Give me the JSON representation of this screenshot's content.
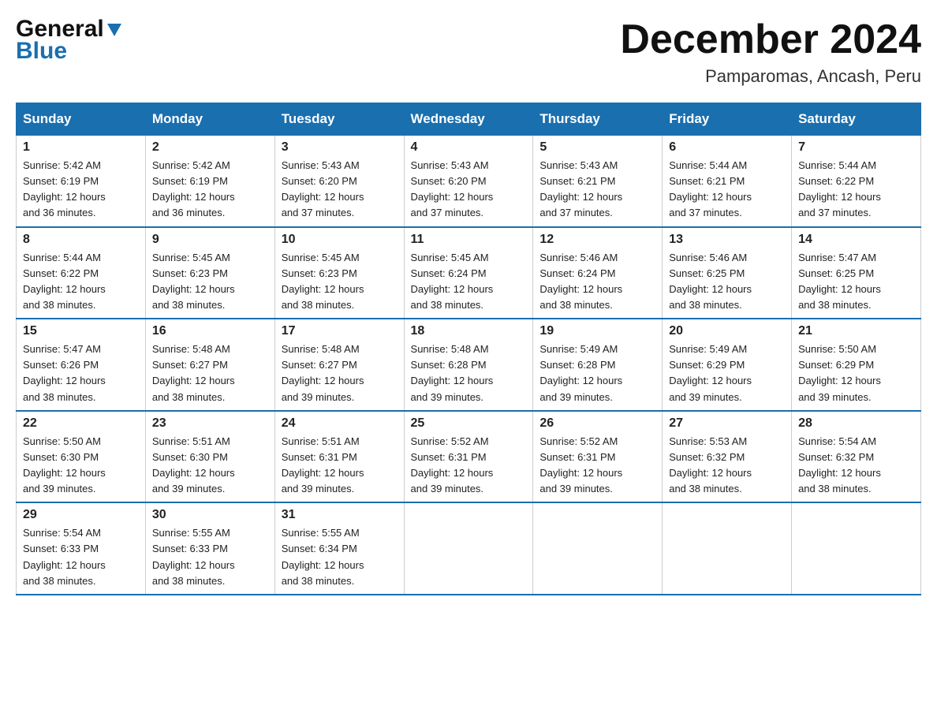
{
  "header": {
    "logo_general": "General",
    "logo_blue": "Blue",
    "month_title": "December 2024",
    "subtitle": "Pamparomas, Ancash, Peru"
  },
  "days_of_week": [
    "Sunday",
    "Monday",
    "Tuesday",
    "Wednesday",
    "Thursday",
    "Friday",
    "Saturday"
  ],
  "weeks": [
    [
      {
        "day": "1",
        "sunrise": "5:42 AM",
        "sunset": "6:19 PM",
        "daylight": "12 hours and 36 minutes."
      },
      {
        "day": "2",
        "sunrise": "5:42 AM",
        "sunset": "6:19 PM",
        "daylight": "12 hours and 36 minutes."
      },
      {
        "day": "3",
        "sunrise": "5:43 AM",
        "sunset": "6:20 PM",
        "daylight": "12 hours and 37 minutes."
      },
      {
        "day": "4",
        "sunrise": "5:43 AM",
        "sunset": "6:20 PM",
        "daylight": "12 hours and 37 minutes."
      },
      {
        "day": "5",
        "sunrise": "5:43 AM",
        "sunset": "6:21 PM",
        "daylight": "12 hours and 37 minutes."
      },
      {
        "day": "6",
        "sunrise": "5:44 AM",
        "sunset": "6:21 PM",
        "daylight": "12 hours and 37 minutes."
      },
      {
        "day": "7",
        "sunrise": "5:44 AM",
        "sunset": "6:22 PM",
        "daylight": "12 hours and 37 minutes."
      }
    ],
    [
      {
        "day": "8",
        "sunrise": "5:44 AM",
        "sunset": "6:22 PM",
        "daylight": "12 hours and 38 minutes."
      },
      {
        "day": "9",
        "sunrise": "5:45 AM",
        "sunset": "6:23 PM",
        "daylight": "12 hours and 38 minutes."
      },
      {
        "day": "10",
        "sunrise": "5:45 AM",
        "sunset": "6:23 PM",
        "daylight": "12 hours and 38 minutes."
      },
      {
        "day": "11",
        "sunrise": "5:45 AM",
        "sunset": "6:24 PM",
        "daylight": "12 hours and 38 minutes."
      },
      {
        "day": "12",
        "sunrise": "5:46 AM",
        "sunset": "6:24 PM",
        "daylight": "12 hours and 38 minutes."
      },
      {
        "day": "13",
        "sunrise": "5:46 AM",
        "sunset": "6:25 PM",
        "daylight": "12 hours and 38 minutes."
      },
      {
        "day": "14",
        "sunrise": "5:47 AM",
        "sunset": "6:25 PM",
        "daylight": "12 hours and 38 minutes."
      }
    ],
    [
      {
        "day": "15",
        "sunrise": "5:47 AM",
        "sunset": "6:26 PM",
        "daylight": "12 hours and 38 minutes."
      },
      {
        "day": "16",
        "sunrise": "5:48 AM",
        "sunset": "6:27 PM",
        "daylight": "12 hours and 38 minutes."
      },
      {
        "day": "17",
        "sunrise": "5:48 AM",
        "sunset": "6:27 PM",
        "daylight": "12 hours and 39 minutes."
      },
      {
        "day": "18",
        "sunrise": "5:48 AM",
        "sunset": "6:28 PM",
        "daylight": "12 hours and 39 minutes."
      },
      {
        "day": "19",
        "sunrise": "5:49 AM",
        "sunset": "6:28 PM",
        "daylight": "12 hours and 39 minutes."
      },
      {
        "day": "20",
        "sunrise": "5:49 AM",
        "sunset": "6:29 PM",
        "daylight": "12 hours and 39 minutes."
      },
      {
        "day": "21",
        "sunrise": "5:50 AM",
        "sunset": "6:29 PM",
        "daylight": "12 hours and 39 minutes."
      }
    ],
    [
      {
        "day": "22",
        "sunrise": "5:50 AM",
        "sunset": "6:30 PM",
        "daylight": "12 hours and 39 minutes."
      },
      {
        "day": "23",
        "sunrise": "5:51 AM",
        "sunset": "6:30 PM",
        "daylight": "12 hours and 39 minutes."
      },
      {
        "day": "24",
        "sunrise": "5:51 AM",
        "sunset": "6:31 PM",
        "daylight": "12 hours and 39 minutes."
      },
      {
        "day": "25",
        "sunrise": "5:52 AM",
        "sunset": "6:31 PM",
        "daylight": "12 hours and 39 minutes."
      },
      {
        "day": "26",
        "sunrise": "5:52 AM",
        "sunset": "6:31 PM",
        "daylight": "12 hours and 39 minutes."
      },
      {
        "day": "27",
        "sunrise": "5:53 AM",
        "sunset": "6:32 PM",
        "daylight": "12 hours and 38 minutes."
      },
      {
        "day": "28",
        "sunrise": "5:54 AM",
        "sunset": "6:32 PM",
        "daylight": "12 hours and 38 minutes."
      }
    ],
    [
      {
        "day": "29",
        "sunrise": "5:54 AM",
        "sunset": "6:33 PM",
        "daylight": "12 hours and 38 minutes."
      },
      {
        "day": "30",
        "sunrise": "5:55 AM",
        "sunset": "6:33 PM",
        "daylight": "12 hours and 38 minutes."
      },
      {
        "day": "31",
        "sunrise": "5:55 AM",
        "sunset": "6:34 PM",
        "daylight": "12 hours and 38 minutes."
      },
      null,
      null,
      null,
      null
    ]
  ],
  "labels": {
    "sunrise": "Sunrise:",
    "sunset": "Sunset:",
    "daylight": "Daylight:"
  }
}
